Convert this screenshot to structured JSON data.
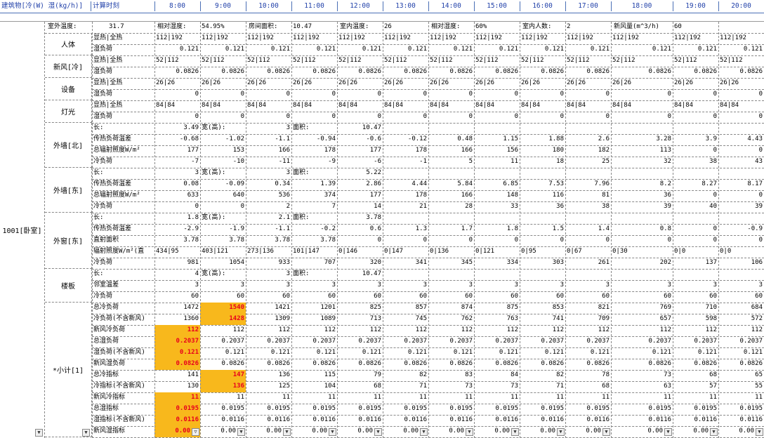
{
  "header": {
    "title": "建筑物[冷(W) 湿(kg/h)]",
    "calc_label": "计算时刻",
    "hours": [
      "8:00",
      "9:00",
      "10:00",
      "11:00",
      "12:00",
      "13:00",
      "14:00",
      "15:00",
      "16:00",
      "17:00",
      "18:00",
      "19:00",
      "20:00"
    ]
  },
  "room": {
    "name": "1001[卧室]"
  },
  "params": [
    [
      "室外温度:",
      "31.7"
    ],
    [
      "相对湿度:",
      "54.95%"
    ],
    [
      "房间面积:",
      "10.47"
    ],
    [
      "室内温度:",
      "26"
    ],
    [
      "相对湿度:",
      "60%"
    ],
    [
      "室内人数:",
      "2"
    ],
    [
      "新风量(m^3/h):",
      "60"
    ]
  ],
  "groups": [
    {
      "label": "人体",
      "rows": [
        {
          "label": "显热|全热",
          "type": "text",
          "vals": [
            "112|192",
            "112|192",
            "112|192",
            "112|192",
            "112|192",
            "112|192",
            "112|192",
            "112|192",
            "112|192",
            "112|192",
            "112|192",
            "112|192",
            "112|192"
          ]
        },
        {
          "label": "湿负荷",
          "vals": [
            "0.121",
            "0.121",
            "0.121",
            "0.121",
            "0.121",
            "0.121",
            "0.121",
            "0.121",
            "0.121",
            "0.121",
            "0.121",
            "0.121",
            "0.121"
          ]
        }
      ]
    },
    {
      "label": "新风[冷]",
      "rows": [
        {
          "label": "显热|全热",
          "type": "text",
          "vals": [
            "52|112",
            "52|112",
            "52|112",
            "52|112",
            "52|112",
            "52|112",
            "52|112",
            "52|112",
            "52|112",
            "52|112",
            "52|112",
            "52|112",
            "52|112"
          ]
        },
        {
          "label": "湿负荷",
          "vals": [
            "0.0826",
            "0.0826",
            "0.0826",
            "0.0826",
            "0.0826",
            "0.0826",
            "0.0826",
            "0.0826",
            "0.0826",
            "0.0826",
            "0.0826",
            "0.0826",
            "0.0826"
          ]
        }
      ]
    },
    {
      "label": "设备",
      "rows": [
        {
          "label": "显热|全热",
          "type": "text",
          "vals": [
            "26|26",
            "26|26",
            "26|26",
            "26|26",
            "26|26",
            "26|26",
            "26|26",
            "26|26",
            "26|26",
            "26|26",
            "26|26",
            "26|26",
            "26|26"
          ]
        },
        {
          "label": "湿负荷",
          "vals": [
            "0",
            "0",
            "0",
            "0",
            "0",
            "0",
            "0",
            "0",
            "0",
            "0",
            "0",
            "0",
            "0"
          ]
        }
      ]
    },
    {
      "label": "灯光",
      "rows": [
        {
          "label": "显热|全热",
          "type": "text",
          "vals": [
            "84|84",
            "84|84",
            "84|84",
            "84|84",
            "84|84",
            "84|84",
            "84|84",
            "84|84",
            "84|84",
            "84|84",
            "84|84",
            "84|84",
            "84|84"
          ]
        },
        {
          "label": "湿负荷",
          "vals": [
            "0",
            "0",
            "0",
            "0",
            "0",
            "0",
            "0",
            "0",
            "0",
            "0",
            "0",
            "0",
            "0"
          ]
        }
      ]
    },
    {
      "label": "外墙[北]",
      "rows": [
        {
          "label": "长:",
          "type": "dim",
          "vals": [
            "3.49",
            "宽(高):",
            "3",
            "面积:",
            "10.47"
          ]
        },
        {
          "label": "传热负荷温差",
          "vals": [
            "-0.68",
            "-1.02",
            "-1.1",
            "-0.94",
            "-0.6",
            "-0.12",
            "0.48",
            "1.15",
            "1.88",
            "2.6",
            "3.28",
            "3.9",
            "4.43"
          ]
        },
        {
          "label": "总辐射照度W/m²",
          "vals": [
            "177",
            "153",
            "166",
            "178",
            "177",
            "178",
            "166",
            "156",
            "180",
            "182",
            "113",
            "0",
            "0"
          ]
        },
        {
          "label": "冷负荷",
          "vals": [
            "-7",
            "-10",
            "-11",
            "-9",
            "-6",
            "-1",
            "5",
            "11",
            "18",
            "25",
            "32",
            "38",
            "43"
          ]
        }
      ]
    },
    {
      "label": "外墙[东]",
      "rows": [
        {
          "label": "长:",
          "type": "dim",
          "vals": [
            "3",
            "宽(高):",
            "3",
            "面积:",
            "5.22"
          ]
        },
        {
          "label": "传热负荷温差",
          "vals": [
            "0.08",
            "-0.09",
            "0.34",
            "1.39",
            "2.86",
            "4.44",
            "5.84",
            "6.85",
            "7.53",
            "7.96",
            "8.2",
            "8.27",
            "8.17"
          ]
        },
        {
          "label": "总辐射照度W/m²",
          "vals": [
            "633",
            "640",
            "536",
            "374",
            "177",
            "178",
            "166",
            "148",
            "116",
            "81",
            "36",
            "0",
            "0"
          ]
        },
        {
          "label": "冷负荷",
          "vals": [
            "0",
            "0",
            "2",
            "7",
            "14",
            "21",
            "28",
            "33",
            "36",
            "38",
            "39",
            "40",
            "39"
          ]
        }
      ]
    },
    {
      "label": "外窗[东]",
      "rows": [
        {
          "label": "长:",
          "type": "dim",
          "vals": [
            "1.8",
            "宽(高):",
            "2.1",
            "面积:",
            "3.78"
          ]
        },
        {
          "label": "传热负荷温差",
          "vals": [
            "-2.9",
            "-1.9",
            "-1.1",
            "-0.2",
            "0.6",
            "1.3",
            "1.7",
            "1.8",
            "1.5",
            "1.4",
            "0.8",
            "0",
            "-0.9"
          ]
        },
        {
          "label": "直射面积",
          "vals": [
            "3.78",
            "3.78",
            "3.78",
            "3.78",
            "0",
            "0",
            "0",
            "0",
            "0",
            "0",
            "0",
            "0",
            "0"
          ]
        },
        {
          "label": "辐射照度W/m²(直",
          "type": "text",
          "vals": [
            "434|95",
            "403|121",
            "273|136",
            "101|147",
            "0|146",
            "0|147",
            "0|136",
            "0|121",
            "0|95",
            "0|67",
            "0|30",
            "0|0",
            "0|0"
          ]
        },
        {
          "label": "冷负荷",
          "vals": [
            "981",
            "1054",
            "933",
            "707",
            "320",
            "341",
            "345",
            "334",
            "303",
            "261",
            "202",
            "137",
            "106"
          ]
        }
      ]
    },
    {
      "label": "楼板",
      "rows": [
        {
          "label": "长:",
          "type": "dim",
          "vals": [
            "4",
            "宽(高):",
            "3",
            "面积:",
            "10.47"
          ]
        },
        {
          "label": "邻室温差",
          "vals": [
            "3",
            "3",
            "3",
            "3",
            "3",
            "3",
            "3",
            "3",
            "3",
            "3",
            "3",
            "3",
            "3"
          ]
        },
        {
          "label": "冷负荷",
          "vals": [
            "60",
            "60",
            "60",
            "60",
            "60",
            "60",
            "60",
            "60",
            "60",
            "60",
            "60",
            "60",
            "60"
          ]
        }
      ]
    },
    {
      "label": "*小计[1]",
      "rows": [
        {
          "label": "总冷负荷",
          "hl": [
            1
          ],
          "vals": [
            "1472",
            "1540",
            "1421",
            "1201",
            "825",
            "857",
            "874",
            "875",
            "853",
            "821",
            "769",
            "710",
            "684"
          ]
        },
        {
          "label": "冷负荷(不含新风)",
          "hl": [
            1
          ],
          "vals": [
            "1360",
            "1428",
            "1309",
            "1089",
            "713",
            "745",
            "762",
            "763",
            "741",
            "709",
            "657",
            "598",
            "572"
          ]
        },
        {
          "label": "新风冷负荷",
          "hl": [
            0
          ],
          "vals": [
            "112",
            "112",
            "112",
            "112",
            "112",
            "112",
            "112",
            "112",
            "112",
            "112",
            "112",
            "112",
            "112"
          ]
        },
        {
          "label": "总湿负荷",
          "hl": [
            0
          ],
          "vals": [
            "0.2037",
            "0.2037",
            "0.2037",
            "0.2037",
            "0.2037",
            "0.2037",
            "0.2037",
            "0.2037",
            "0.2037",
            "0.2037",
            "0.2037",
            "0.2037",
            "0.2037"
          ]
        },
        {
          "label": "湿负荷(不含新风)",
          "hl": [
            0
          ],
          "vals": [
            "0.121",
            "0.121",
            "0.121",
            "0.121",
            "0.121",
            "0.121",
            "0.121",
            "0.121",
            "0.121",
            "0.121",
            "0.121",
            "0.121",
            "0.121"
          ]
        },
        {
          "label": "新风湿负荷",
          "hl": [
            0
          ],
          "vals": [
            "0.0826",
            "0.0826",
            "0.0826",
            "0.0826",
            "0.0826",
            "0.0826",
            "0.0826",
            "0.0826",
            "0.0826",
            "0.0826",
            "0.0826",
            "0.0826",
            "0.0826"
          ]
        },
        {
          "label": "总冷指标",
          "hl": [
            1
          ],
          "vals": [
            "141",
            "147",
            "136",
            "115",
            "79",
            "82",
            "83",
            "84",
            "82",
            "78",
            "73",
            "68",
            "65"
          ]
        },
        {
          "label": "冷指标(不含新风)",
          "hl": [
            1
          ],
          "vals": [
            "130",
            "136",
            "125",
            "104",
            "68",
            "71",
            "73",
            "73",
            "71",
            "68",
            "63",
            "57",
            "55"
          ]
        },
        {
          "label": "新风冷指标",
          "hl": [
            0
          ],
          "vals": [
            "11",
            "11",
            "11",
            "11",
            "11",
            "11",
            "11",
            "11",
            "11",
            "11",
            "11",
            "11",
            "11"
          ]
        },
        {
          "label": "总湿指标",
          "hl": [
            0
          ],
          "vals": [
            "0.0195",
            "0.0195",
            "0.0195",
            "0.0195",
            "0.0195",
            "0.0195",
            "0.0195",
            "0.0195",
            "0.0195",
            "0.0195",
            "0.0195",
            "0.0195",
            "0.0195"
          ]
        },
        {
          "label": "湿指标(不含新风)",
          "hl": [
            0
          ],
          "vals": [
            "0.0116",
            "0.0116",
            "0.0116",
            "0.0116",
            "0.0116",
            "0.0116",
            "0.0116",
            "0.0116",
            "0.0116",
            "0.0116",
            "0.0116",
            "0.0116",
            "0.0116"
          ]
        },
        {
          "label": "新风湿指标",
          "hl": [
            0
          ],
          "filter": true,
          "vals": [
            "0.00",
            "0.00",
            "0.00",
            "0.00",
            "0.00",
            "0.00",
            "0.00",
            "0.00",
            "0.00",
            "0.00",
            "0.00",
            "0.00",
            "0.00"
          ]
        }
      ]
    }
  ],
  "icons": {
    "filter": "dropdown-arrow-icon",
    "active_filter": "funnel-icon"
  },
  "colors": {
    "highlight": "#f8b81c",
    "highlight_text": "#e8001c",
    "header_text": "#1f3fa8"
  }
}
